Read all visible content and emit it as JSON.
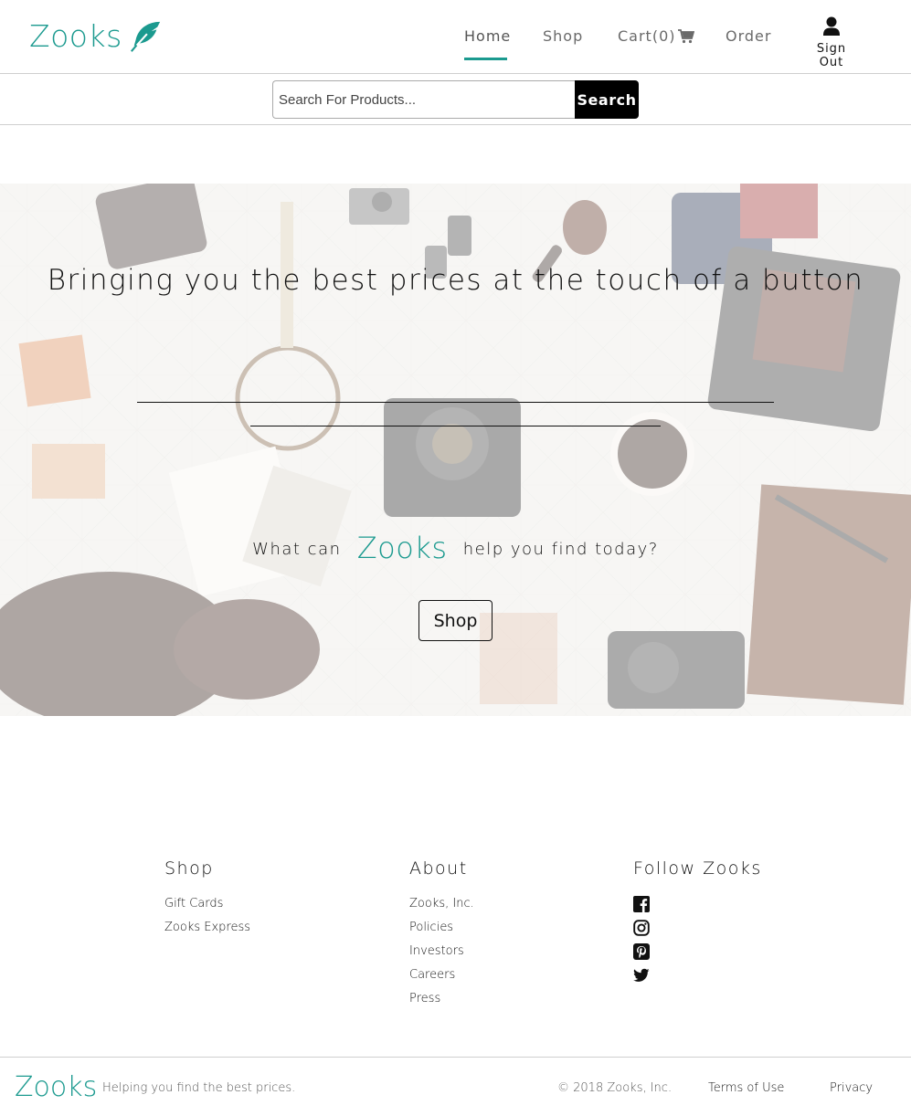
{
  "brand": {
    "name": "Zooks",
    "accent_color": "#1b9a8f",
    "logo_icon": "feather-icon"
  },
  "nav": {
    "home": "Home",
    "shop": "Shop",
    "cart": "Cart(0)",
    "cart_icon": "shopping-cart-icon",
    "order": "Order",
    "signout": "Sign Out",
    "signout_icon": "user-icon",
    "active": "Home"
  },
  "search": {
    "placeholder": "Search For Products...",
    "value": "",
    "button_label": "Search"
  },
  "hero": {
    "title": "Bringing you the best prices at the touch of a button",
    "ask_before": "What can",
    "ask_brand": "Zooks",
    "ask_after": "help you find today?",
    "shop_button": "Shop"
  },
  "footer": {
    "shop": {
      "heading": "Shop",
      "links": [
        "Gift Cards",
        "Zooks Express"
      ]
    },
    "about": {
      "heading": "About",
      "links": [
        "Zooks, Inc.",
        "Policies",
        "Investors",
        "Careers",
        "Press"
      ]
    },
    "follow": {
      "heading": "Follow Zooks",
      "icons": [
        "facebook-icon",
        "instagram-icon",
        "pinterest-icon",
        "twitter-icon"
      ]
    }
  },
  "bottom": {
    "logo": "Zooks",
    "tagline": "Helping you find the best prices.",
    "copyright": "© 2018 Zooks, Inc.",
    "terms": "Terms of Use",
    "privacy": "Privacy"
  }
}
